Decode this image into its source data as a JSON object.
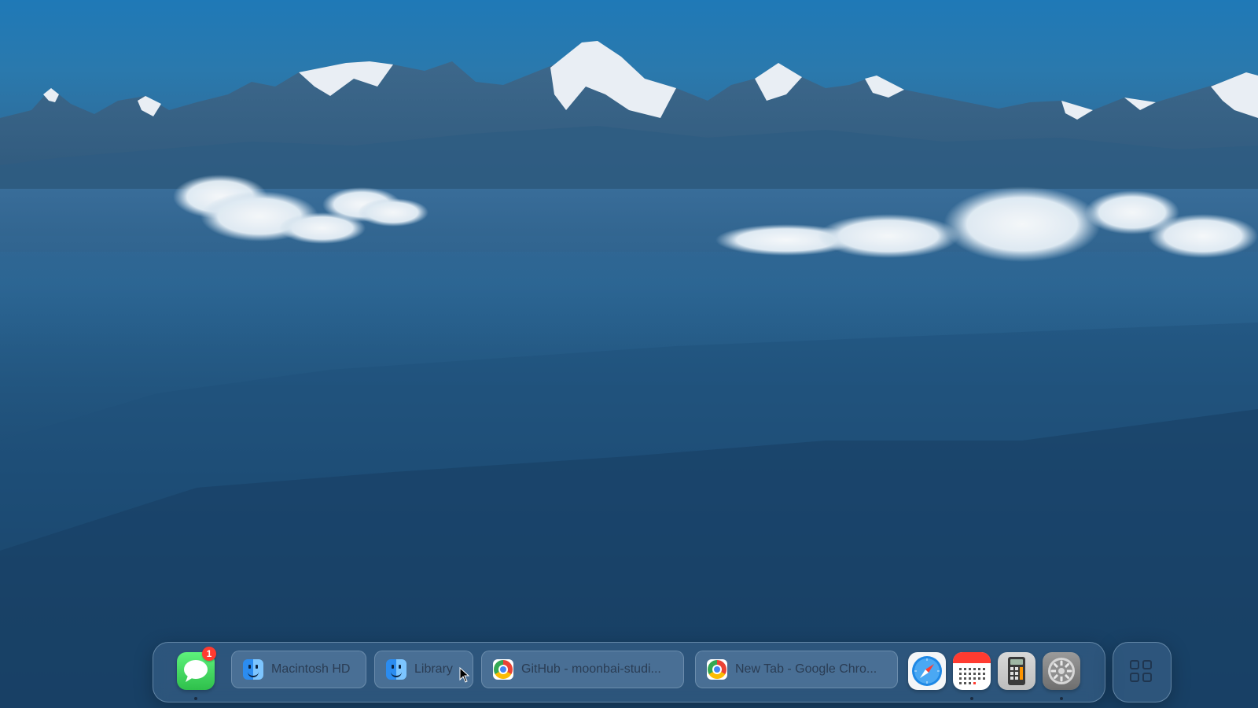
{
  "desktop": {
    "wallpaper": "mountain-range-above-clouds"
  },
  "dock": {
    "apps_left": [
      {
        "name": "Messages",
        "icon": "messages-icon",
        "badge": "1",
        "running": true
      }
    ],
    "windows": [
      {
        "label": "Macintosh HD",
        "icon": "finder-icon"
      },
      {
        "label": "Library",
        "icon": "finder-icon"
      },
      {
        "label": "GitHub - moonbai-studi...",
        "icon": "chrome-icon"
      },
      {
        "label": "New Tab - Google Chro...",
        "icon": "chrome-icon"
      }
    ],
    "apps_right": [
      {
        "name": "Safari",
        "icon": "safari-icon",
        "running": false
      },
      {
        "name": "Calendar",
        "icon": "calendar-icon",
        "running": true
      },
      {
        "name": "Calculator",
        "icon": "calculator-icon",
        "running": false
      },
      {
        "name": "System Settings",
        "icon": "system-settings-icon",
        "running": true
      }
    ],
    "launchpad": {
      "icon": "app-grid-icon"
    }
  },
  "colors": {
    "badge": "#ff3b30",
    "messages_green": "#34c759",
    "safari_blue": "#1e88e5"
  }
}
